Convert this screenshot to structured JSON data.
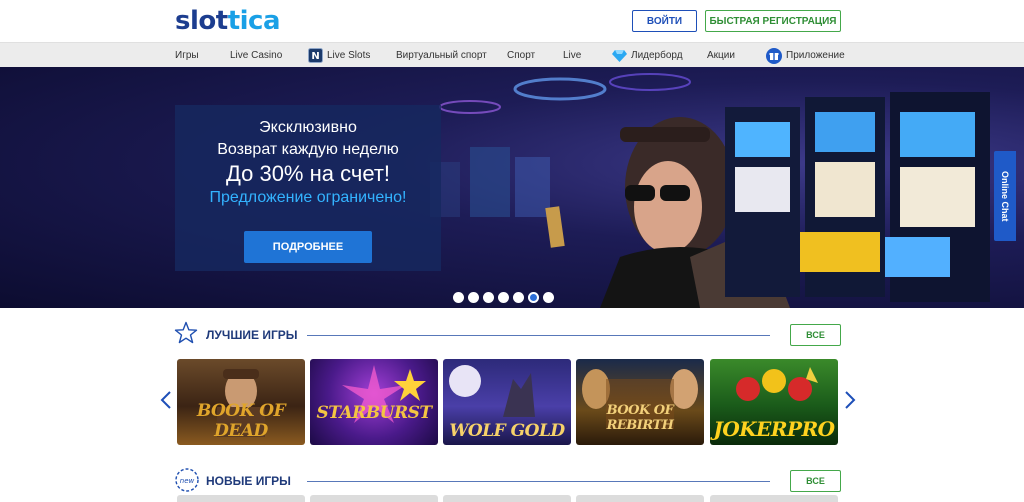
{
  "header": {
    "logo_main": "slot",
    "logo_accent": "tica",
    "login_label": "ВОЙТИ",
    "register_label": "БЫСТРАЯ РЕГИСТРАЦИЯ"
  },
  "nav": {
    "items": [
      {
        "label": "Игры"
      },
      {
        "label": "Live Casino"
      },
      {
        "label": "Live Slots",
        "icon": "netent-icon"
      },
      {
        "label": "Виртуальный спорт"
      },
      {
        "label": "Спорт"
      },
      {
        "label": "Live"
      },
      {
        "label": "Лидерборд",
        "icon": "diamond-icon"
      },
      {
        "label": "Акции"
      },
      {
        "label": "Приложение",
        "icon": "gift-icon"
      }
    ]
  },
  "hero": {
    "line1": "Эксклюзивно",
    "line2": "Возврат каждую неделю",
    "line3": "До 30% на счет!",
    "line4": "Предложение ограничено!",
    "button_label": "ПОДРОБНЕЕ",
    "slide_count": 7,
    "active_slide": 6
  },
  "online_chat": {
    "label": "Online Chat"
  },
  "best_games": {
    "title": "ЛУЧШИЕ ИГРЫ",
    "all_label": "ВСЕ",
    "icon": "star-icon",
    "games": [
      {
        "title": "BOOK OF DEAD",
        "color": "#e0a52b"
      },
      {
        "title": "STARBURST",
        "color": "#f4c542"
      },
      {
        "title": "WOLF GOLD",
        "color": "#f6d26a"
      },
      {
        "title": "BOOK OF REBIRTH",
        "color": "#f2d07a"
      },
      {
        "title": "JOKERPRO",
        "color": "#ffd21f"
      }
    ]
  },
  "new_games": {
    "title": "НОВЫЕ ИГРЫ",
    "all_label": "ВСЕ",
    "icon": "new-badge-icon",
    "badge": "new"
  },
  "colors": {
    "brand": "#1c3d8f",
    "accent": "#1aa0e6",
    "green": "#44a84a",
    "button_blue": "#1f74d6"
  }
}
